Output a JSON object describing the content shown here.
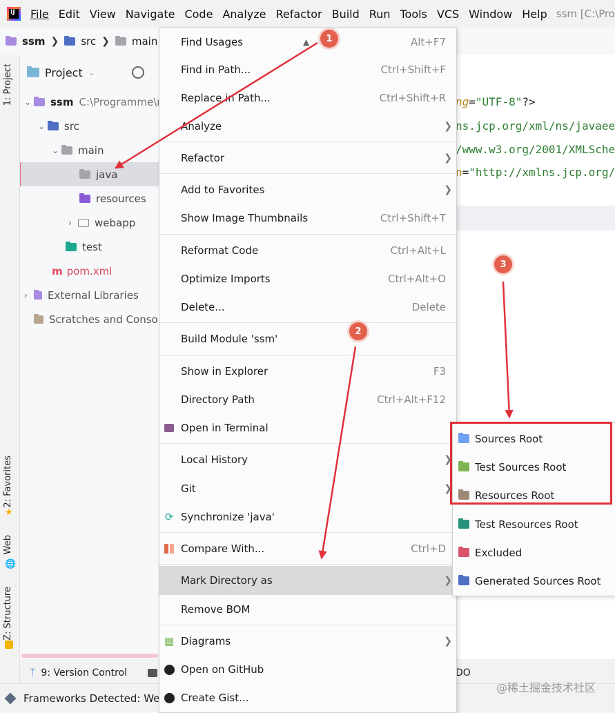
{
  "menubar": {
    "items": [
      "File",
      "Edit",
      "View",
      "Navigate",
      "Code",
      "Analyze",
      "Refactor",
      "Build",
      "Run",
      "Tools",
      "VCS",
      "Window",
      "Help"
    ],
    "title": "ssm [C:\\Pro"
  },
  "breadcrumb": {
    "project": "ssm",
    "src": "src",
    "main": "main"
  },
  "left_strip": {
    "project": "1: Project",
    "favorites": "2: Favorites",
    "web": "Web",
    "structure": "Z: Structure"
  },
  "project_panel": {
    "header": "Project",
    "tree": {
      "ssm_name": "ssm",
      "ssm_path": "C:\\Programme\\r",
      "src": "src",
      "main": "main",
      "java": "java",
      "resources": "resources",
      "webapp": "webapp",
      "test": "test",
      "pom": "pom.xml",
      "external": "External Libraries",
      "scratches": "Scratches and Consol"
    }
  },
  "editor": {
    "line1_attr": "ng",
    "line1_eq": "=",
    "line1_val": "\"UTF-8\"",
    "line1_end": "?>",
    "line2": "ns.jcp.org/xml/ns/javaee",
    "line3": "/www.w3.org/2001/XMLSche",
    "line4_attr": "n",
    "line4_eq": "=",
    "line4_val": "\"http://xmlns.jcp.org/"
  },
  "context_menu": {
    "find_usages": {
      "label": "Find Usages",
      "shortcut": "Alt+F7"
    },
    "find_in_path": {
      "label": "Find in Path...",
      "shortcut": "Ctrl+Shift+F"
    },
    "replace_in_path": {
      "label": "Replace in Path...",
      "shortcut": "Ctrl+Shift+R"
    },
    "analyze": {
      "label": "Analyze"
    },
    "refactor": {
      "label": "Refactor"
    },
    "add_favorites": {
      "label": "Add to Favorites"
    },
    "thumbnails": {
      "label": "Show Image Thumbnails",
      "shortcut": "Ctrl+Shift+T"
    },
    "reformat": {
      "label": "Reformat Code",
      "shortcut": "Ctrl+Alt+L"
    },
    "optimize": {
      "label": "Optimize Imports",
      "shortcut": "Ctrl+Alt+O"
    },
    "delete": {
      "label": "Delete...",
      "shortcut": "Delete"
    },
    "build_module": {
      "label": "Build Module 'ssm'"
    },
    "show_explorer": {
      "label": "Show in Explorer",
      "shortcut": "F3"
    },
    "directory_path": {
      "label": "Directory Path",
      "shortcut": "Ctrl+Alt+F12"
    },
    "open_terminal": {
      "label": "Open in Terminal"
    },
    "local_history": {
      "label": "Local History"
    },
    "git": {
      "label": "Git"
    },
    "synchronize": {
      "label": "Synchronize 'java'"
    },
    "compare": {
      "label": "Compare With...",
      "shortcut": "Ctrl+D"
    },
    "mark_directory": {
      "label": "Mark Directory as"
    },
    "remove_bom": {
      "label": "Remove BOM"
    },
    "diagrams": {
      "label": "Diagrams"
    },
    "open_github": {
      "label": "Open on GitHub"
    },
    "create_gist": {
      "label": "Create Gist..."
    }
  },
  "submenu": {
    "items": [
      {
        "label": "Sources Root",
        "color": "#6e9ff0"
      },
      {
        "label": "Test Sources Root",
        "color": "#7db351"
      },
      {
        "label": "Resources Root",
        "color": "#9c8a74"
      },
      {
        "label": "Test Resources Root",
        "color": "#27917b"
      },
      {
        "label": "Excluded",
        "color": "#d9546a"
      },
      {
        "label": "Generated Sources Root",
        "color": "#4e6fc4"
      }
    ]
  },
  "annotations": {
    "badge1": "1",
    "badge2": "2",
    "badge3": "3",
    "arrow_color": "#e0303a",
    "box_color": "#e0303a"
  },
  "bottom_tabs": {
    "version_control": "9: Version Control",
    "terminal": "T",
    "todo": "DO"
  },
  "statusbar": {
    "frameworks": "Frameworks Detected: Wel"
  },
  "watermark": "@稀土掘金技术社区",
  "colors": {
    "folder_gray": "#a3a5aa",
    "source_blue": "#6e9ff0",
    "resources_purple": "#8a5cd6",
    "test_teal": "#1ea890",
    "maven_red": "#e04b5f",
    "code_green": "#2e7d32",
    "code_attr": "#b58a1e"
  }
}
